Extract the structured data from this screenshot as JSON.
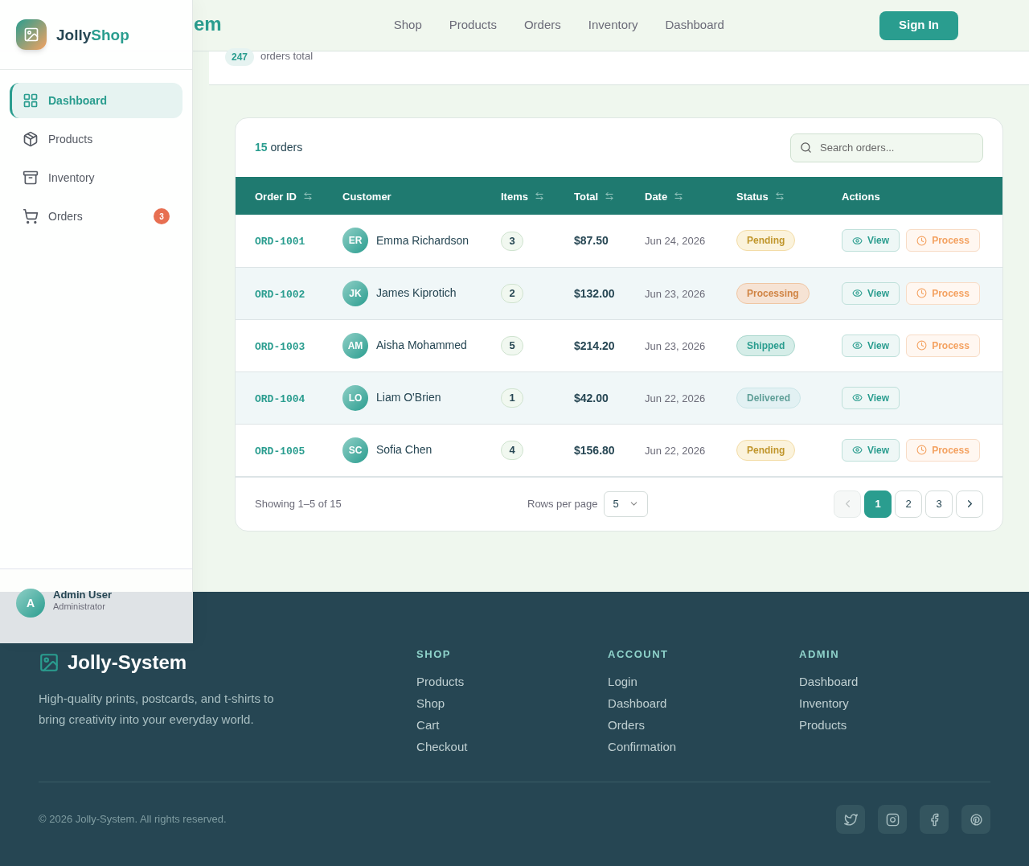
{
  "header": {
    "logo": "em",
    "nav": [
      "Shop",
      "Products",
      "Orders",
      "Inventory",
      "Dashboard"
    ],
    "sign_in": "Sign In"
  },
  "summary": {
    "count": "247",
    "label": "orders total"
  },
  "sidebar": {
    "brand_first": "Jolly",
    "brand_second": "Shop",
    "items": [
      {
        "label": "Dashboard",
        "selected": true
      },
      {
        "label": "Products",
        "selected": false
      },
      {
        "label": "Inventory",
        "selected": false
      },
      {
        "label": "Orders",
        "selected": false,
        "badge": "3"
      }
    ],
    "user": {
      "initial": "A",
      "name": "Admin User",
      "role": "Administrator"
    }
  },
  "orders": {
    "count": "15",
    "count_label": "orders",
    "search": {
      "placeholder": "Search orders..."
    },
    "columns": [
      {
        "label": "Order ID",
        "sortable": true
      },
      {
        "label": "Customer",
        "sortable": false
      },
      {
        "label": "Items",
        "sortable": true
      },
      {
        "label": "Total",
        "sortable": true
      },
      {
        "label": "Date",
        "sortable": true
      },
      {
        "label": "Status",
        "sortable": true
      },
      {
        "label": "Actions",
        "sortable": false
      }
    ],
    "rows": [
      {
        "id": "ORD-1001",
        "initials": "ER",
        "customer": "Emma Richardson",
        "items": "3",
        "total": "$87.50",
        "date": "Jun 24, 2026",
        "status": {
          "label": "Pending",
          "kind": "pending"
        },
        "actions": [
          {
            "label": "View",
            "kind": "view"
          },
          {
            "label": "Process",
            "kind": "process"
          }
        ]
      },
      {
        "id": "ORD-1002",
        "initials": "JK",
        "customer": "James Kiprotich",
        "items": "2",
        "total": "$132.00",
        "date": "Jun 23, 2026",
        "status": {
          "label": "Processing",
          "kind": "processing"
        },
        "actions": [
          {
            "label": "View",
            "kind": "view"
          },
          {
            "label": "Process",
            "kind": "process"
          }
        ]
      },
      {
        "id": "ORD-1003",
        "initials": "AM",
        "customer": "Aisha Mohammed",
        "items": "5",
        "total": "$214.20",
        "date": "Jun 23, 2026",
        "status": {
          "label": "Shipped",
          "kind": "shipped"
        },
        "actions": [
          {
            "label": "View",
            "kind": "view"
          },
          {
            "label": "Process",
            "kind": "process"
          }
        ]
      },
      {
        "id": "ORD-1004",
        "initials": "LO",
        "customer": "Liam O'Brien",
        "items": "1",
        "total": "$42.00",
        "date": "Jun 22, 2026",
        "status": {
          "label": "Delivered",
          "kind": "delivered"
        },
        "actions": [
          {
            "label": "View",
            "kind": "view"
          }
        ]
      },
      {
        "id": "ORD-1005",
        "initials": "SC",
        "customer": "Sofia Chen",
        "items": "4",
        "total": "$156.80",
        "date": "Jun 22, 2026",
        "status": {
          "label": "Pending",
          "kind": "pending"
        },
        "actions": [
          {
            "label": "View",
            "kind": "view"
          },
          {
            "label": "Process",
            "kind": "process"
          }
        ]
      }
    ],
    "pagination": {
      "showing": "Showing 1–5 of 15",
      "rows_label": "Rows per page",
      "rows_value": "5",
      "prev_disabled": true,
      "pages": [
        {
          "label": "1",
          "selected": true
        },
        {
          "label": "2",
          "selected": false
        },
        {
          "label": "3",
          "selected": false
        }
      ]
    }
  },
  "footer": {
    "brand": "Jolly-System",
    "tagline": "High-quality prints, postcards, and t-shirts to bring creativity into your everyday world.",
    "columns": [
      {
        "title": "SHOP",
        "links": [
          "Products",
          "Shop",
          "Cart",
          "Checkout"
        ]
      },
      {
        "title": "ACCOUNT",
        "links": [
          "Login",
          "Dashboard",
          "Orders",
          "Confirmation"
        ]
      },
      {
        "title": "ADMIN",
        "links": [
          "Dashboard",
          "Inventory",
          "Products"
        ]
      }
    ],
    "copyright": "© 2026 Jolly-System. All rights reserved."
  }
}
